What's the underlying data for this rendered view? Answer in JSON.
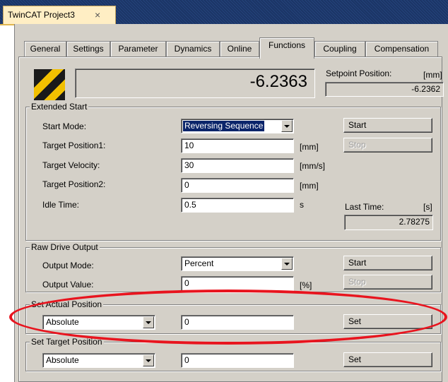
{
  "document_tab": {
    "title": "TwinCAT Project3",
    "close_glyph": "×"
  },
  "tabs": [
    {
      "label": "General"
    },
    {
      "label": "Settings"
    },
    {
      "label": "Parameter"
    },
    {
      "label": "Dynamics"
    },
    {
      "label": "Online"
    },
    {
      "label": "Functions",
      "active": true
    },
    {
      "label": "Coupling"
    },
    {
      "label": "Compensation"
    }
  ],
  "header": {
    "actual_position": "-6.2363",
    "setpoint_label": "Setpoint Position:",
    "setpoint_unit": "[mm]",
    "setpoint_value": "-6.2362"
  },
  "extended_start": {
    "title": "Extended Start",
    "start_mode_label": "Start Mode:",
    "start_mode_value": "Reversing Sequence",
    "target_position1_label": "Target Position1:",
    "target_position1_value": "10",
    "target_position1_unit": "[mm]",
    "target_velocity_label": "Target Velocity:",
    "target_velocity_value": "30",
    "target_velocity_unit": "[mm/s]",
    "target_position2_label": "Target Position2:",
    "target_position2_value": "0",
    "target_position2_unit": "[mm]",
    "idle_time_label": "Idle Time:",
    "idle_time_value": "0.5",
    "idle_time_unit": "s",
    "start_button": "Start",
    "stop_button": "Stop",
    "last_time_label": "Last Time:",
    "last_time_unit": "[s]",
    "last_time_value": "2.78275"
  },
  "raw_drive_output": {
    "title": "Raw Drive Output",
    "output_mode_label": "Output Mode:",
    "output_mode_value": "Percent",
    "output_value_label": "Output Value:",
    "output_value": "0",
    "output_value_unit": "[%]",
    "start_button": "Start",
    "stop_button": "Stop"
  },
  "set_actual_position": {
    "title": "Set Actual Position",
    "mode_value": "Absolute",
    "value": "0",
    "set_button": "Set"
  },
  "set_target_position": {
    "title": "Set Target Position",
    "mode_value": "Absolute",
    "value": "0",
    "set_button": "Set"
  },
  "colors": {
    "highlight": "#e8141e",
    "dialog_face": "#d4d0c8",
    "doc_tab": "#ffeec4"
  }
}
